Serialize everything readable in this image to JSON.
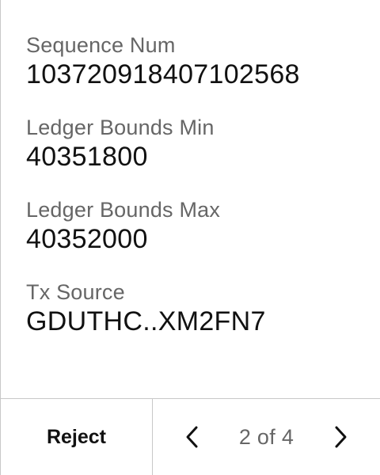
{
  "fields": [
    {
      "label": "Sequence Num",
      "value": "103720918407102568"
    },
    {
      "label": "Ledger Bounds Min",
      "value": "40351800"
    },
    {
      "label": "Ledger Bounds Max",
      "value": "40352000"
    },
    {
      "label": "Tx Source",
      "value": "GDUTHC..XM2FN7"
    }
  ],
  "footer": {
    "reject_label": "Reject",
    "page_indicator": "2 of 4",
    "prev_icon": "chevron-left-icon",
    "next_icon": "chevron-right-icon"
  },
  "colors": {
    "label": "#666666",
    "value": "#111111",
    "border": "#c8c8c8",
    "background": "#ffffff"
  }
}
